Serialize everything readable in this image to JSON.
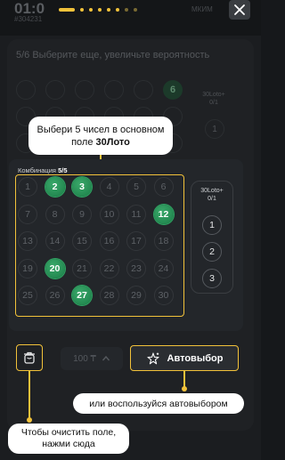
{
  "background": {
    "time": "01:0",
    "id": "#304231",
    "right_text": "МКИМ",
    "title": "5/6 Выберите еще, увеличьте вероятность",
    "six": "6",
    "side_label": "30Loto+\n0/1",
    "side_one": "1"
  },
  "tour": {
    "step_dots": 8,
    "active_dot": 0
  },
  "tooltips": {
    "main_text": "Выбери 5 чисел в основном поле",
    "main_bold": "30Лото",
    "auto": "или воспользуйся автовыбором",
    "clear": "Чтобы очистить поле, нажми сюда"
  },
  "panel": {
    "combo_label": "Комбинация",
    "combo_count": "5/5",
    "numbers": [
      "1",
      "2",
      "3",
      "4",
      "5",
      "6",
      "7",
      "8",
      "9",
      "10",
      "11",
      "12",
      "13",
      "14",
      "15",
      "16",
      "17",
      "18",
      "19",
      "20",
      "21",
      "22",
      "23",
      "24",
      "25",
      "26",
      "27",
      "28",
      "29",
      "30"
    ],
    "selected": [
      "2",
      "3",
      "12",
      "20",
      "27"
    ],
    "side_label_line1": "30Loto+",
    "side_label_line2": "0/1",
    "side_numbers": [
      "1",
      "2",
      "3"
    ]
  },
  "controls": {
    "price": "100 ₸",
    "auto_label": "Автовыбор"
  },
  "colors": {
    "accent": "#f2c23a",
    "selected_ball": "#2a9a5a"
  },
  "icons": {
    "close": "close-icon",
    "trash": "trash-icon",
    "auto": "sparkle-star-icon",
    "chevron": "chevron-up-icon"
  }
}
